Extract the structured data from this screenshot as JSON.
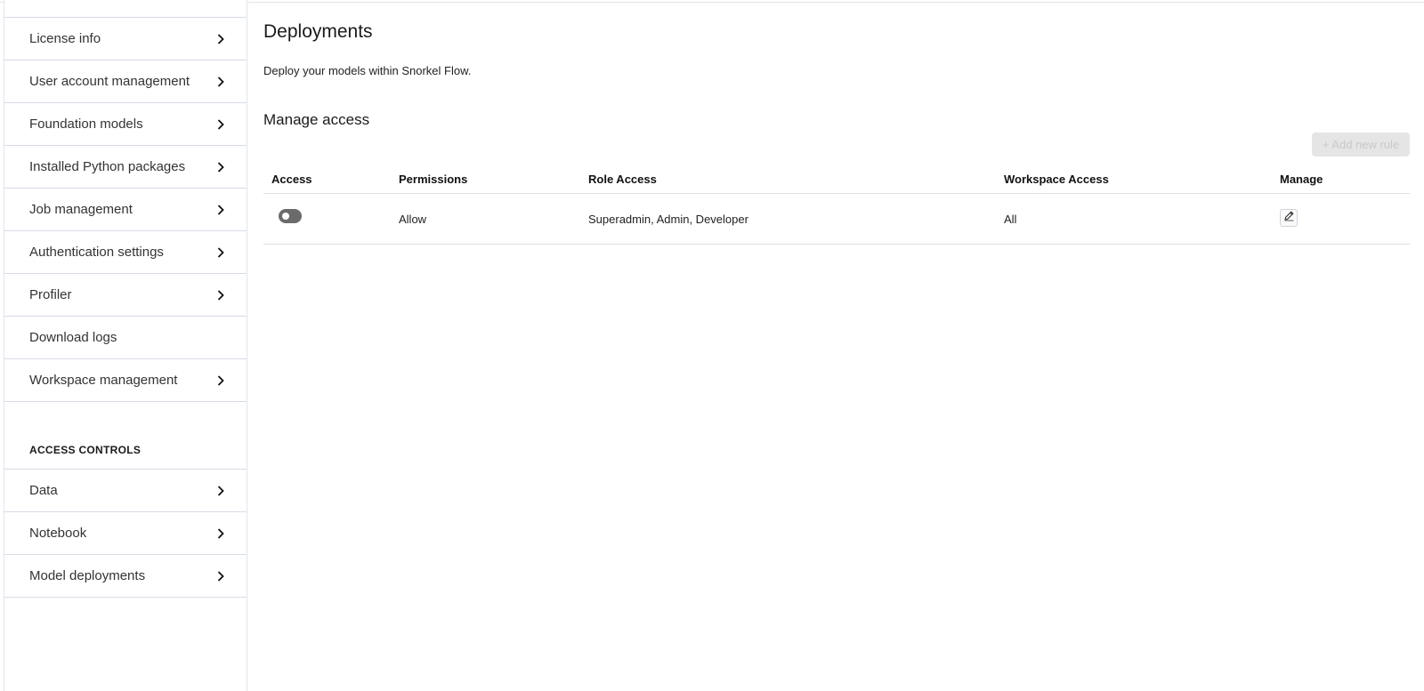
{
  "sidebar": {
    "items": [
      {
        "label": "License info",
        "chevron": true
      },
      {
        "label": "User account management",
        "chevron": true
      },
      {
        "label": "Foundation models",
        "chevron": true
      },
      {
        "label": "Installed Python packages",
        "chevron": true
      },
      {
        "label": "Job management",
        "chevron": true
      },
      {
        "label": "Authentication settings",
        "chevron": true
      },
      {
        "label": "Profiler",
        "chevron": true
      },
      {
        "label": "Download logs",
        "chevron": false
      },
      {
        "label": "Workspace management",
        "chevron": true
      }
    ],
    "access_section_title": "ACCESS CONTROLS",
    "access_items": [
      {
        "label": "Data",
        "chevron": true
      },
      {
        "label": "Notebook",
        "chevron": true
      },
      {
        "label": "Model deployments",
        "chevron": true
      }
    ]
  },
  "main": {
    "title": "Deployments",
    "description": "Deploy your models within Snorkel Flow.",
    "section_title": "Manage access",
    "add_button_label": "+ Add new rule",
    "table": {
      "headers": {
        "access": "Access",
        "permissions": "Permissions",
        "role_access": "Role Access",
        "workspace_access": "Workspace Access",
        "manage": "Manage"
      },
      "rows": [
        {
          "access_enabled": false,
          "permissions": "Allow",
          "role_access": "Superadmin, Admin, Developer",
          "workspace_access": "All"
        }
      ]
    }
  },
  "icons": {
    "chevron": "chevron-right-icon",
    "edit": "pencil-icon"
  },
  "colors": {
    "toggle_off": "#6b6b6b",
    "button_disabled_bg": "#e5e5e5",
    "button_disabled_text": "#c9c9c9",
    "divider": "#d7dce6"
  }
}
